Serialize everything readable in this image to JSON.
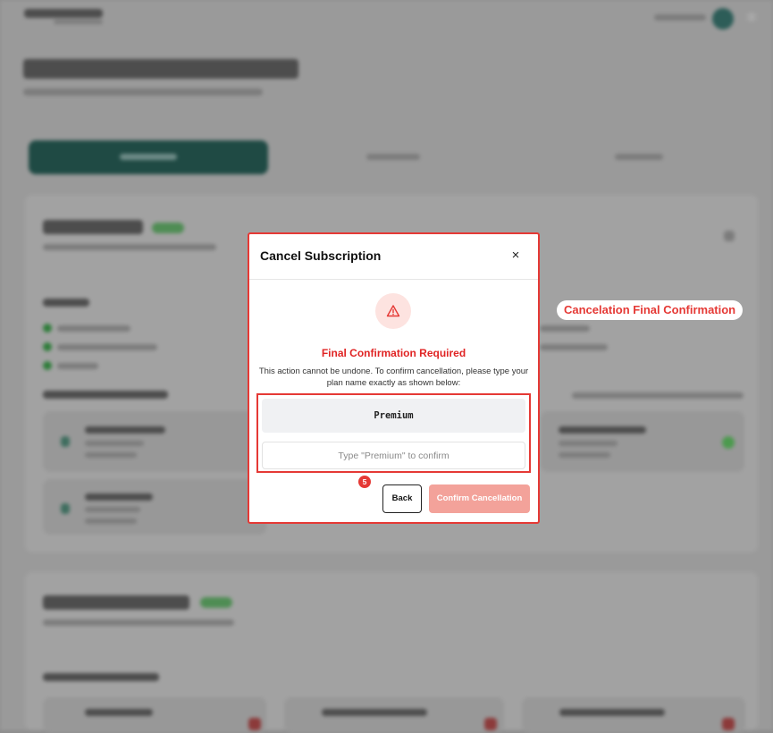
{
  "modal": {
    "title": "Cancel Subscription",
    "close_label": "×",
    "heading": "Final Confirmation Required",
    "description": "This action cannot be undone. To confirm cancellation, please type your plan name exactly as shown below:",
    "plan_name": "Premium",
    "input_placeholder": "Type \"Premium\" to confirm",
    "input_value": "",
    "step_badge": "5",
    "back_label": "Back",
    "confirm_label": "Confirm Cancellation"
  },
  "annotation": {
    "label": "Cancelation Final Confirmation"
  },
  "colors": {
    "accent_red": "#e53935",
    "confirm_disabled": "#f3a29a",
    "warning_bg": "#fde3e0",
    "active_tab": "#1f4a44"
  },
  "icons": {
    "warning": "warning-triangle-icon",
    "close": "close-icon"
  }
}
